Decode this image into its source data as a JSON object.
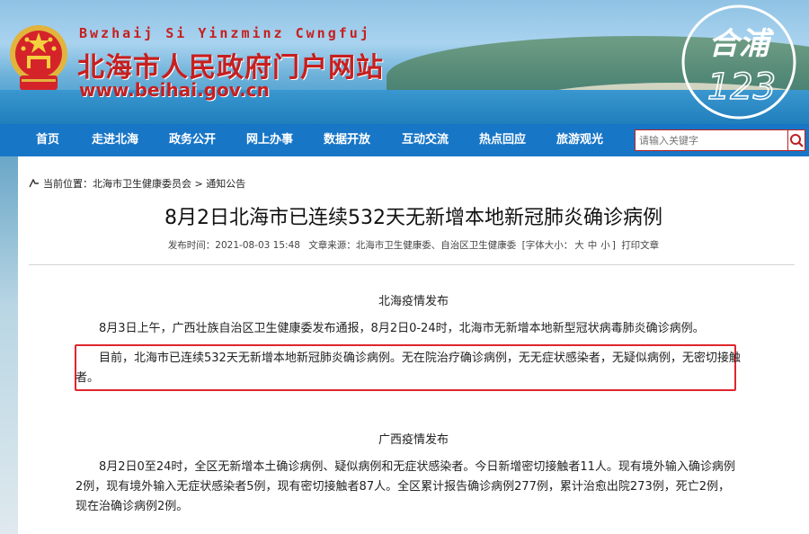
{
  "header": {
    "site_name_en": "Bwzhaij Si Yinzminz Cwngfuj",
    "site_name_cn": "北海市人民政府门户网站",
    "site_url": "www.beihai.gov.cn",
    "badge_text_top": "合浦",
    "badge_text_bottom": "123"
  },
  "nav": {
    "items": [
      "首页",
      "走进北海",
      "政务公开",
      "网上办事",
      "数据开放",
      "互动交流",
      "热点回应",
      "旅游观光"
    ],
    "search_placeholder": "请输入关键字"
  },
  "breadcrumb": {
    "prefix": "当前位置：",
    "path": "北海市卫生健康委员会 > 通知公告"
  },
  "article": {
    "title": "8月2日北海市已连续532天无新增本地新冠肺炎确诊病例",
    "publish_label": "发布时间：2021-08-03 15:48",
    "source_label": "文章来源：北海市卫生健康委、自治区卫生健康委",
    "font_size_label": "[字体大小：",
    "font_size_options": [
      "大",
      "中",
      "小"
    ],
    "font_size_close": "]",
    "print_label": "打印文章",
    "section1_heading": "北海疫情发布",
    "section1_p1": "8月3日上午，广西壮族自治区卫生健康委发布通报，8月2日0-24时，北海市无新增本地新型冠状病毒肺炎确诊病例。",
    "section1_p2": "目前，北海市已连续532天无新增本地新冠肺炎确诊病例。无在院治疗确诊病例，无无症状感染者，无疑似病例，无密切接触者。",
    "section2_heading": "广西疫情发布",
    "section2_p1": "8月2日0至24时，全区无新增本土确诊病例、疑似病例和无症状感染者。今日新增密切接触者11人。现有境外输入确诊病例2例，现有境外输入无症状感染者5例，现有密切接触者87人。全区累计报告确诊病例277例，累计治愈出院273例，死亡2例，现在治确诊病例2例。"
  },
  "colors": {
    "nav_bg": "#1876c7",
    "brand_red": "#c61f1f",
    "highlight_border": "#e0262c"
  }
}
